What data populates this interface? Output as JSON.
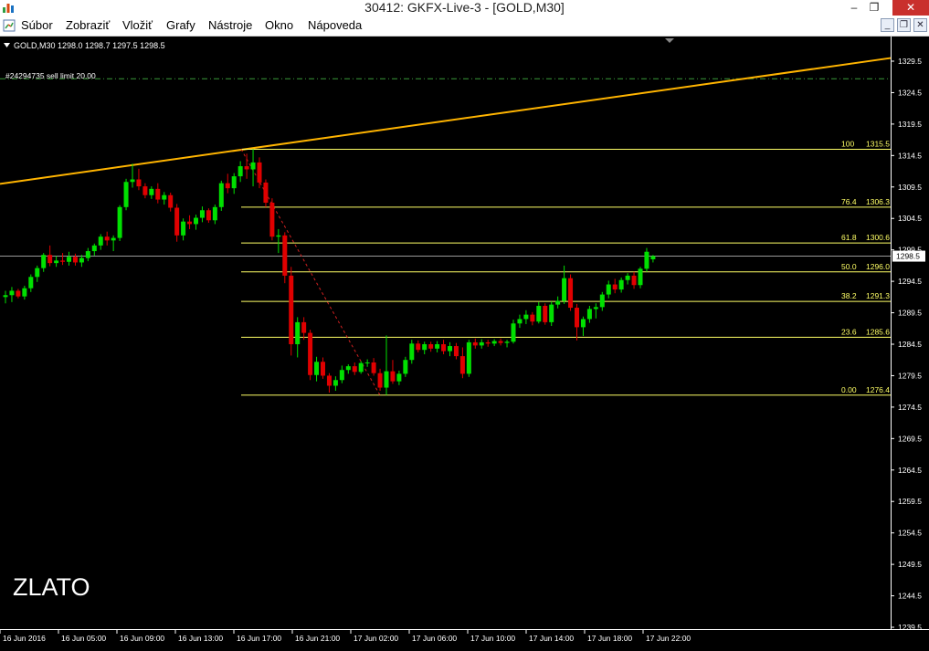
{
  "window": {
    "title": "30412: GKFX-Live-3 - [GOLD,M30]",
    "controls": {
      "minimize": "–",
      "maximize": "❐",
      "close": "✕"
    }
  },
  "menu": {
    "items": [
      "Súbor",
      "Zobraziť",
      "Vložiť",
      "Grafy",
      "Nástroje",
      "Okno",
      "Nápoveda"
    ],
    "mdi_controls": {
      "minimize": "_",
      "restore": "❐",
      "close": "✕"
    }
  },
  "chart": {
    "header": "GOLD,M30  1298.0 1298.7 1297.5 1298.5",
    "order_label": "#24294735 sell limit 20.00",
    "watermark": "ZLATO",
    "price_axis_ticks": [
      "1329.5",
      "1324.5",
      "1319.5",
      "1314.5",
      "1309.5",
      "1304.5",
      "1299.5",
      "1294.5",
      "1289.5",
      "1284.5",
      "1279.5",
      "1274.5",
      "1269.5",
      "1264.5",
      "1259.5",
      "1254.5",
      "1249.5",
      "1244.5",
      "1239.5"
    ],
    "current_price_label": "1298.5",
    "time_axis_labels": [
      "16 Jun 2016",
      "16 Jun 05:00",
      "16 Jun 09:00",
      "16 Jun 13:00",
      "16 Jun 17:00",
      "16 Jun 21:00",
      "17 Jun 02:00",
      "17 Jun 06:00",
      "17 Jun 10:00",
      "17 Jun 14:00",
      "17 Jun 18:00",
      "17 Jun 22:00"
    ],
    "fibonacci_levels": [
      {
        "ratio": "100",
        "price": "1315.5"
      },
      {
        "ratio": "76.4",
        "price": "1306.3"
      },
      {
        "ratio": "61.8",
        "price": "1300.6"
      },
      {
        "ratio": "50.0",
        "price": "1296.0"
      },
      {
        "ratio": "38.2",
        "price": "1291.3"
      },
      {
        "ratio": "23.6",
        "price": "1285.6"
      },
      {
        "ratio": "0.00",
        "price": "1276.4"
      }
    ],
    "colors": {
      "bull": "#00e000",
      "bear": "#e00000",
      "fib": "#ffff66",
      "trendline": "#ffb400",
      "order_line": "#3a9a3a",
      "text": "#ffffff"
    }
  },
  "chart_data": {
    "type": "candlestick",
    "symbol": "GOLD",
    "timeframe": "M30",
    "ylim": [
      1237.5,
      1332
    ],
    "last_price": 1298.5,
    "candles": [
      {
        "o": 1292.0,
        "h": 1293.0,
        "l": 1291.0,
        "c": 1292.3
      },
      {
        "o": 1292.3,
        "h": 1293.6,
        "l": 1291.2,
        "c": 1293.0
      },
      {
        "o": 1293.0,
        "h": 1293.3,
        "l": 1291.8,
        "c": 1292.1
      },
      {
        "o": 1292.1,
        "h": 1293.8,
        "l": 1291.6,
        "c": 1293.4
      },
      {
        "o": 1293.4,
        "h": 1295.6,
        "l": 1292.8,
        "c": 1295.2
      },
      {
        "o": 1295.2,
        "h": 1297.0,
        "l": 1294.4,
        "c": 1296.6
      },
      {
        "o": 1296.6,
        "h": 1299.0,
        "l": 1296.0,
        "c": 1298.7
      },
      {
        "o": 1298.7,
        "h": 1300.2,
        "l": 1296.9,
        "c": 1297.4
      },
      {
        "o": 1297.4,
        "h": 1298.5,
        "l": 1296.8,
        "c": 1297.8
      },
      {
        "o": 1297.8,
        "h": 1299.0,
        "l": 1297.1,
        "c": 1297.6
      },
      {
        "o": 1297.6,
        "h": 1299.2,
        "l": 1297.0,
        "c": 1298.4
      },
      {
        "o": 1298.4,
        "h": 1298.9,
        "l": 1297.0,
        "c": 1297.5
      },
      {
        "o": 1297.5,
        "h": 1298.7,
        "l": 1296.8,
        "c": 1298.2
      },
      {
        "o": 1298.2,
        "h": 1299.8,
        "l": 1297.7,
        "c": 1299.3
      },
      {
        "o": 1299.3,
        "h": 1300.5,
        "l": 1298.6,
        "c": 1300.2
      },
      {
        "o": 1300.2,
        "h": 1302.0,
        "l": 1299.5,
        "c": 1301.6
      },
      {
        "o": 1301.6,
        "h": 1302.4,
        "l": 1300.2,
        "c": 1301.0
      },
      {
        "o": 1301.0,
        "h": 1301.8,
        "l": 1299.3,
        "c": 1301.4
      },
      {
        "o": 1301.4,
        "h": 1306.6,
        "l": 1300.9,
        "c": 1306.3
      },
      {
        "o": 1306.3,
        "h": 1310.8,
        "l": 1305.8,
        "c": 1310.3
      },
      {
        "o": 1310.3,
        "h": 1313.2,
        "l": 1309.4,
        "c": 1310.7
      },
      {
        "o": 1310.7,
        "h": 1312.4,
        "l": 1309.0,
        "c": 1309.6
      },
      {
        "o": 1309.6,
        "h": 1310.1,
        "l": 1307.7,
        "c": 1308.2
      },
      {
        "o": 1308.2,
        "h": 1309.6,
        "l": 1307.6,
        "c": 1309.2
      },
      {
        "o": 1309.2,
        "h": 1310.1,
        "l": 1306.9,
        "c": 1307.5
      },
      {
        "o": 1307.5,
        "h": 1308.7,
        "l": 1306.7,
        "c": 1308.2
      },
      {
        "o": 1308.2,
        "h": 1308.6,
        "l": 1305.6,
        "c": 1306.2
      },
      {
        "o": 1306.2,
        "h": 1306.8,
        "l": 1300.8,
        "c": 1301.8
      },
      {
        "o": 1301.8,
        "h": 1304.5,
        "l": 1301.0,
        "c": 1304.0
      },
      {
        "o": 1304.0,
        "h": 1305.0,
        "l": 1302.8,
        "c": 1303.6
      },
      {
        "o": 1303.6,
        "h": 1305.1,
        "l": 1302.7,
        "c": 1304.6
      },
      {
        "o": 1304.6,
        "h": 1306.4,
        "l": 1303.9,
        "c": 1305.8
      },
      {
        "o": 1305.8,
        "h": 1306.1,
        "l": 1303.8,
        "c": 1304.2
      },
      {
        "o": 1304.2,
        "h": 1306.7,
        "l": 1303.6,
        "c": 1306.3
      },
      {
        "o": 1306.3,
        "h": 1310.5,
        "l": 1305.7,
        "c": 1310.1
      },
      {
        "o": 1310.1,
        "h": 1311.6,
        "l": 1308.5,
        "c": 1309.3
      },
      {
        "o": 1309.3,
        "h": 1311.7,
        "l": 1308.4,
        "c": 1311.2
      },
      {
        "o": 1311.2,
        "h": 1313.6,
        "l": 1310.3,
        "c": 1312.8
      },
      {
        "o": 1312.8,
        "h": 1314.8,
        "l": 1310.8,
        "c": 1312.3
      },
      {
        "o": 1312.3,
        "h": 1315.5,
        "l": 1309.6,
        "c": 1313.4
      },
      {
        "o": 1313.4,
        "h": 1314.2,
        "l": 1309.3,
        "c": 1310.2
      },
      {
        "o": 1310.2,
        "h": 1310.7,
        "l": 1306.3,
        "c": 1307.0
      },
      {
        "o": 1307.0,
        "h": 1307.7,
        "l": 1301.0,
        "c": 1301.6
      },
      {
        "o": 1301.6,
        "h": 1302.8,
        "l": 1299.0,
        "c": 1301.8
      },
      {
        "o": 1301.8,
        "h": 1302.3,
        "l": 1294.2,
        "c": 1295.4
      },
      {
        "o": 1295.4,
        "h": 1296.8,
        "l": 1282.7,
        "c": 1284.5
      },
      {
        "o": 1284.5,
        "h": 1288.8,
        "l": 1282.4,
        "c": 1288.0
      },
      {
        "o": 1288.0,
        "h": 1288.8,
        "l": 1285.2,
        "c": 1286.3
      },
      {
        "o": 1286.3,
        "h": 1286.8,
        "l": 1278.8,
        "c": 1279.6
      },
      {
        "o": 1279.6,
        "h": 1282.5,
        "l": 1278.6,
        "c": 1281.7
      },
      {
        "o": 1281.7,
        "h": 1282.4,
        "l": 1279.0,
        "c": 1279.5
      },
      {
        "o": 1279.5,
        "h": 1279.9,
        "l": 1276.8,
        "c": 1277.9
      },
      {
        "o": 1277.9,
        "h": 1279.4,
        "l": 1277.1,
        "c": 1278.8
      },
      {
        "o": 1278.8,
        "h": 1281.1,
        "l": 1278.3,
        "c": 1280.4
      },
      {
        "o": 1280.4,
        "h": 1281.3,
        "l": 1279.8,
        "c": 1281.0
      },
      {
        "o": 1281.0,
        "h": 1281.6,
        "l": 1279.6,
        "c": 1280.1
      },
      {
        "o": 1280.1,
        "h": 1281.8,
        "l": 1279.8,
        "c": 1281.5
      },
      {
        "o": 1281.5,
        "h": 1282.1,
        "l": 1280.9,
        "c": 1281.6
      },
      {
        "o": 1281.6,
        "h": 1282.3,
        "l": 1279.5,
        "c": 1279.9
      },
      {
        "o": 1279.9,
        "h": 1280.6,
        "l": 1277.1,
        "c": 1277.6
      },
      {
        "o": 1277.6,
        "h": 1285.9,
        "l": 1276.4,
        "c": 1280.2
      },
      {
        "o": 1280.2,
        "h": 1282.0,
        "l": 1278.2,
        "c": 1278.6
      },
      {
        "o": 1278.6,
        "h": 1280.3,
        "l": 1278.0,
        "c": 1279.8
      },
      {
        "o": 1279.8,
        "h": 1282.5,
        "l": 1279.3,
        "c": 1282.0
      },
      {
        "o": 1282.0,
        "h": 1285.2,
        "l": 1281.4,
        "c": 1284.6
      },
      {
        "o": 1284.6,
        "h": 1285.1,
        "l": 1283.2,
        "c": 1283.6
      },
      {
        "o": 1283.6,
        "h": 1284.9,
        "l": 1282.9,
        "c": 1284.5
      },
      {
        "o": 1284.5,
        "h": 1284.9,
        "l": 1283.3,
        "c": 1283.8
      },
      {
        "o": 1283.8,
        "h": 1285.0,
        "l": 1283.2,
        "c": 1284.5
      },
      {
        "o": 1284.5,
        "h": 1285.2,
        "l": 1282.9,
        "c": 1283.4
      },
      {
        "o": 1283.4,
        "h": 1284.8,
        "l": 1282.6,
        "c": 1284.2
      },
      {
        "o": 1284.2,
        "h": 1284.7,
        "l": 1282.1,
        "c": 1282.6
      },
      {
        "o": 1282.6,
        "h": 1284.0,
        "l": 1279.1,
        "c": 1279.8
      },
      {
        "o": 1279.8,
        "h": 1285.2,
        "l": 1279.3,
        "c": 1284.8
      },
      {
        "o": 1284.8,
        "h": 1285.4,
        "l": 1283.8,
        "c": 1284.3
      },
      {
        "o": 1284.3,
        "h": 1285.3,
        "l": 1283.8,
        "c": 1284.8
      },
      {
        "o": 1284.8,
        "h": 1285.2,
        "l": 1284.1,
        "c": 1284.6
      },
      {
        "o": 1284.6,
        "h": 1285.3,
        "l": 1284.2,
        "c": 1285.0
      },
      {
        "o": 1285.0,
        "h": 1285.4,
        "l": 1284.3,
        "c": 1284.7
      },
      {
        "o": 1284.7,
        "h": 1285.2,
        "l": 1284.0,
        "c": 1284.9
      },
      {
        "o": 1284.9,
        "h": 1288.4,
        "l": 1284.6,
        "c": 1287.8
      },
      {
        "o": 1287.8,
        "h": 1289.2,
        "l": 1287.1,
        "c": 1288.5
      },
      {
        "o": 1288.5,
        "h": 1289.9,
        "l": 1287.7,
        "c": 1289.2
      },
      {
        "o": 1289.2,
        "h": 1289.6,
        "l": 1287.5,
        "c": 1288.1
      },
      {
        "o": 1288.1,
        "h": 1291.2,
        "l": 1287.8,
        "c": 1290.6
      },
      {
        "o": 1290.6,
        "h": 1291.0,
        "l": 1287.6,
        "c": 1288.0
      },
      {
        "o": 1288.0,
        "h": 1291.3,
        "l": 1287.4,
        "c": 1290.8
      },
      {
        "o": 1290.8,
        "h": 1292.1,
        "l": 1290.2,
        "c": 1291.4
      },
      {
        "o": 1291.4,
        "h": 1297.0,
        "l": 1290.9,
        "c": 1295.0
      },
      {
        "o": 1295.0,
        "h": 1295.6,
        "l": 1289.8,
        "c": 1290.3
      },
      {
        "o": 1290.3,
        "h": 1290.9,
        "l": 1285.1,
        "c": 1287.2
      },
      {
        "o": 1287.2,
        "h": 1288.9,
        "l": 1285.8,
        "c": 1288.5
      },
      {
        "o": 1288.5,
        "h": 1290.6,
        "l": 1287.9,
        "c": 1290.1
      },
      {
        "o": 1290.1,
        "h": 1291.0,
        "l": 1288.6,
        "c": 1290.4
      },
      {
        "o": 1290.4,
        "h": 1292.8,
        "l": 1289.8,
        "c": 1292.4
      },
      {
        "o": 1292.4,
        "h": 1294.6,
        "l": 1291.8,
        "c": 1294.0
      },
      {
        "o": 1294.0,
        "h": 1294.9,
        "l": 1292.6,
        "c": 1293.2
      },
      {
        "o": 1293.2,
        "h": 1295.1,
        "l": 1292.7,
        "c": 1294.7
      },
      {
        "o": 1294.7,
        "h": 1295.8,
        "l": 1294.0,
        "c": 1295.4
      },
      {
        "o": 1295.4,
        "h": 1296.0,
        "l": 1293.3,
        "c": 1293.9
      },
      {
        "o": 1293.9,
        "h": 1296.8,
        "l": 1293.4,
        "c": 1296.5
      },
      {
        "o": 1296.5,
        "h": 1299.8,
        "l": 1296.0,
        "c": 1299.2
      },
      {
        "o": 1298.0,
        "h": 1298.7,
        "l": 1297.5,
        "c": 1298.5
      }
    ],
    "trendline_prices": [
      1310.0,
      1330.0
    ],
    "order_line_price": 1326.7,
    "fib_swing": {
      "high": 1315.5,
      "low": 1276.4
    },
    "current_price_line": 1298.5
  }
}
